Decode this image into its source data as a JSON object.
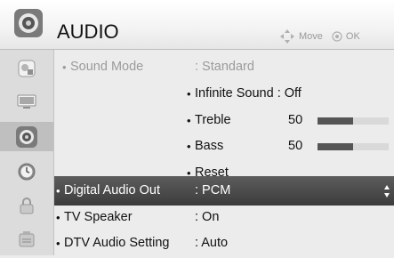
{
  "header": {
    "title": "AUDIO",
    "move_hint": "Move",
    "ok_hint": "OK"
  },
  "sidebar": {
    "items": [
      {
        "name": "picture",
        "icon": "picture-icon",
        "active": false
      },
      {
        "name": "screen",
        "icon": "monitor-icon",
        "active": false
      },
      {
        "name": "audio",
        "icon": "speaker-icon",
        "active": true
      },
      {
        "name": "time",
        "icon": "clock-icon",
        "active": false
      },
      {
        "name": "lock",
        "icon": "lock-icon",
        "active": false
      },
      {
        "name": "option",
        "icon": "option-icon",
        "active": false
      }
    ]
  },
  "menu": {
    "sound_mode": {
      "bullet": "•",
      "label": "Sound Mode",
      "value": ": Standard"
    },
    "infinite_sound": {
      "bullet": "•",
      "text": "Infinite Sound : Off"
    },
    "treble": {
      "bullet": "•",
      "label": "Treble",
      "value": "50",
      "level": 0.5
    },
    "bass": {
      "bullet": "•",
      "label": "Bass",
      "value": "50",
      "level": 0.5
    },
    "reset": {
      "bullet": "•",
      "label": "Reset"
    },
    "digital_audio_out": {
      "bullet": "•",
      "label": "Digital Audio Out",
      "value": ": PCM"
    },
    "tv_speaker": {
      "bullet": "•",
      "label": "TV Speaker",
      "value": ": On"
    },
    "dtv_audio_setting": {
      "bullet": "•",
      "label": "DTV Audio Setting",
      "value": ": Auto"
    }
  },
  "colors": {
    "selected_bar": "#4a4a4a",
    "disabled_text": "#9b9b9b",
    "slider_fill": "#555555"
  }
}
